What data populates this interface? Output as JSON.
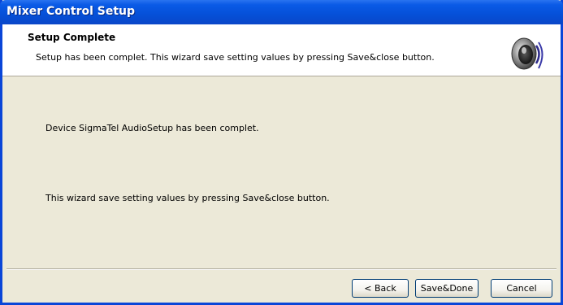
{
  "window": {
    "title": "Mixer Control Setup"
  },
  "header": {
    "title": "Setup Complete",
    "subtitle": "Setup has been complet. This wizard save setting values by pressing Save&close button.",
    "icon": "speaker-icon"
  },
  "body": {
    "line1": "Device SigmaTel AudioSetup has been complet.",
    "line2": "This wizard save setting values by pressing Save&close button."
  },
  "buttons": {
    "back": "< Back",
    "save_done": "Save&Done",
    "cancel": "Cancel"
  },
  "colors": {
    "titlebar": "#0a5ae6",
    "dialog_bg": "#ece9d8",
    "header_bg": "#ffffff"
  }
}
